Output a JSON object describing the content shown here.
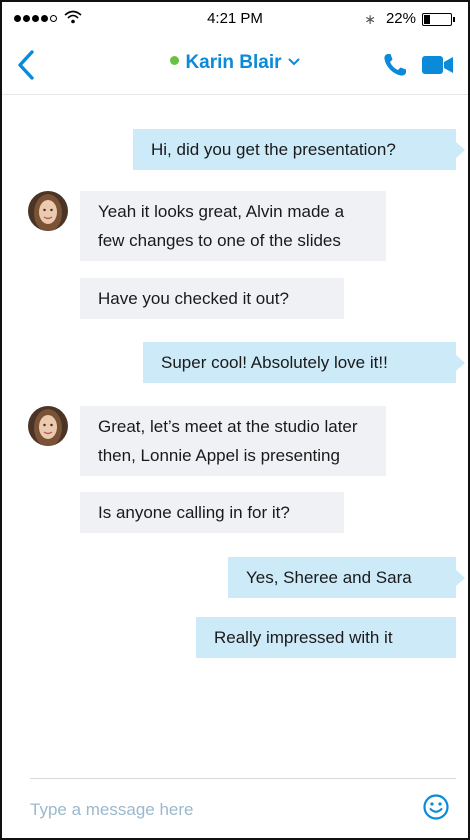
{
  "status_bar": {
    "time": "4:21 PM",
    "battery_percent": "22%",
    "battery_level": 0.22,
    "icons": [
      "signal-dots-icon",
      "wifi-icon",
      "bluetooth-icon",
      "battery-icon"
    ]
  },
  "header": {
    "contact_name": "Karin Blair",
    "presence_color": "#6ac045",
    "accent_color": "#0a8ad8",
    "icons": [
      "back-chevron-icon",
      "chevron-down-icon",
      "phone-icon",
      "video-camera-icon"
    ]
  },
  "messages": [
    {
      "direction": "out",
      "lines": [
        "Hi, did you get the presentation?"
      ]
    },
    {
      "direction": "in",
      "lines": [
        "Yeah it looks great, Alvin made a",
        "few changes to one of the slides"
      ]
    },
    {
      "direction": "in",
      "lines": [
        "Have you checked it out?"
      ]
    },
    {
      "direction": "out",
      "lines": [
        "Super cool! Absolutely love it!!"
      ]
    },
    {
      "direction": "in",
      "lines": [
        "Great, let’s meet at the studio later",
        "then, Lonnie Appel is presenting"
      ]
    },
    {
      "direction": "in",
      "lines": [
        "Is anyone calling in for it?"
      ]
    },
    {
      "direction": "out",
      "lines": [
        "Yes, Sheree and Sara"
      ]
    },
    {
      "direction": "out",
      "lines": [
        "Really impressed with it"
      ]
    }
  ],
  "composer": {
    "placeholder": "Type a message here",
    "icons": [
      "emoji-icon"
    ]
  },
  "colors": {
    "outgoing_bubble": "#cdeaf9",
    "incoming_bubble": "#eff1f4"
  }
}
